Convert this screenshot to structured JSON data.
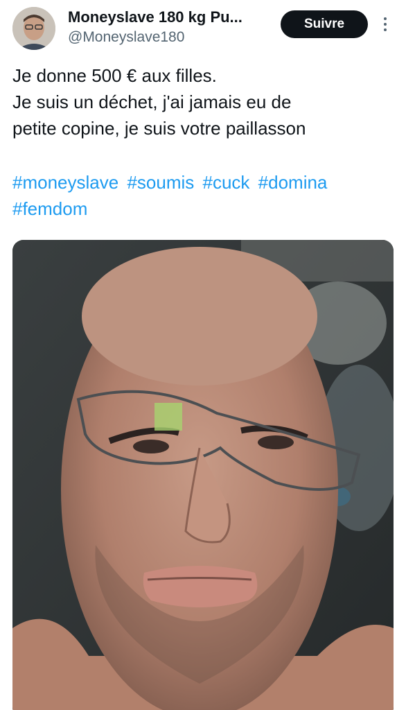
{
  "author": {
    "display_name": "Moneyslave 180 kg Pu...",
    "handle": "@Moneyslave180"
  },
  "actions": {
    "follow_label": "Suivre",
    "more_icon": "more-vertical-icon"
  },
  "tweet": {
    "lines": [
      "Je donne 500 € aux filles.",
      "Je suis un déchet, j'ai jamais eu de",
      "petite copine, je suis votre paillasson"
    ],
    "hashtags": [
      "#moneyslave",
      "#soumis",
      "#cuck",
      "#domina",
      "#femdom"
    ]
  },
  "colors": {
    "link": "#1d9bf0",
    "text": "#0f1419",
    "secondary": "#536471",
    "button_bg": "#0f1419"
  }
}
